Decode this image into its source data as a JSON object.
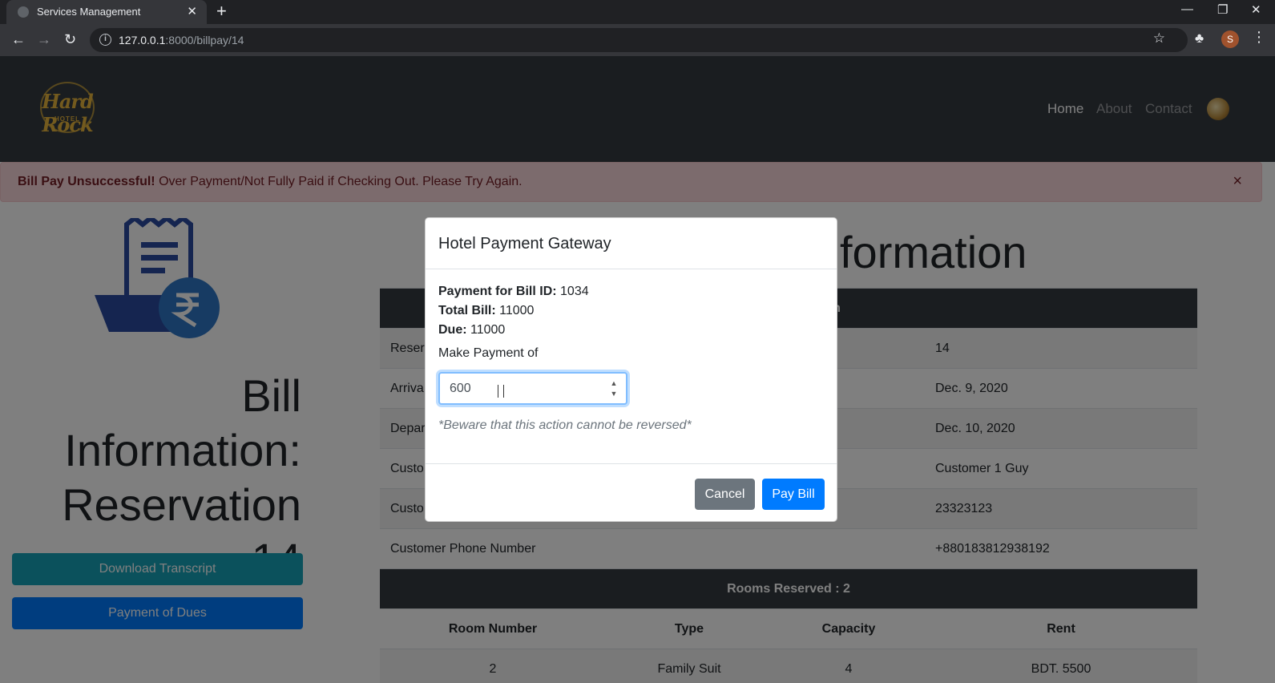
{
  "browser": {
    "tab_title": "Services Management",
    "tab_close": "✕",
    "new_tab": "+",
    "url_host": "127.0.0.1",
    "url_path": ":8000/billpay/14",
    "profile_initial": "S"
  },
  "navbar": {
    "logo_text": "Hard Rock",
    "logo_sub": "HOTEL",
    "links": [
      "Home",
      "About",
      "Contact"
    ]
  },
  "alert": {
    "strong": "Bill Pay Unsuccessful!",
    "message": " Over Payment/Not Fully Paid if Checking Out. Please Try Again.",
    "close": "×"
  },
  "left": {
    "heading_line1": "Bill",
    "heading_line2": "Information:",
    "heading_line3": "Reservation 14",
    "download_button": "Download Transcript",
    "payment_button": "Payment of Dues"
  },
  "main": {
    "title_partial": "formation",
    "header_partial": "n",
    "rows": [
      {
        "label": "Reser",
        "value": "14"
      },
      {
        "label": "Arriva",
        "value": "Dec. 9, 2020"
      },
      {
        "label": "Depar",
        "value": "Dec. 10, 2020"
      },
      {
        "label": "Custo",
        "value": "Customer 1 Guy"
      },
      {
        "label": "Custo",
        "value": "23323123"
      },
      {
        "label": "Customer Phone Number",
        "value": "+880183812938192"
      }
    ],
    "rooms_header": "Rooms Reserved : 2",
    "room_columns": [
      "Room Number",
      "Type",
      "Capacity",
      "Rent"
    ],
    "room_row": [
      "2",
      "Family Suit",
      "4",
      "BDT. 5500"
    ]
  },
  "modal": {
    "title": "Hotel Payment Gateway",
    "bill_id_label": "Payment for Bill ID:",
    "bill_id": " 1034",
    "total_label": "Total Bill:",
    "total": " 11000",
    "due_label": "Due:",
    "due": " 11000",
    "make_payment_label": "Make Payment of",
    "payment_value": "600",
    "warning": "*Beware that this action cannot be reversed*",
    "cancel": "Cancel",
    "pay": "Pay Bill"
  }
}
